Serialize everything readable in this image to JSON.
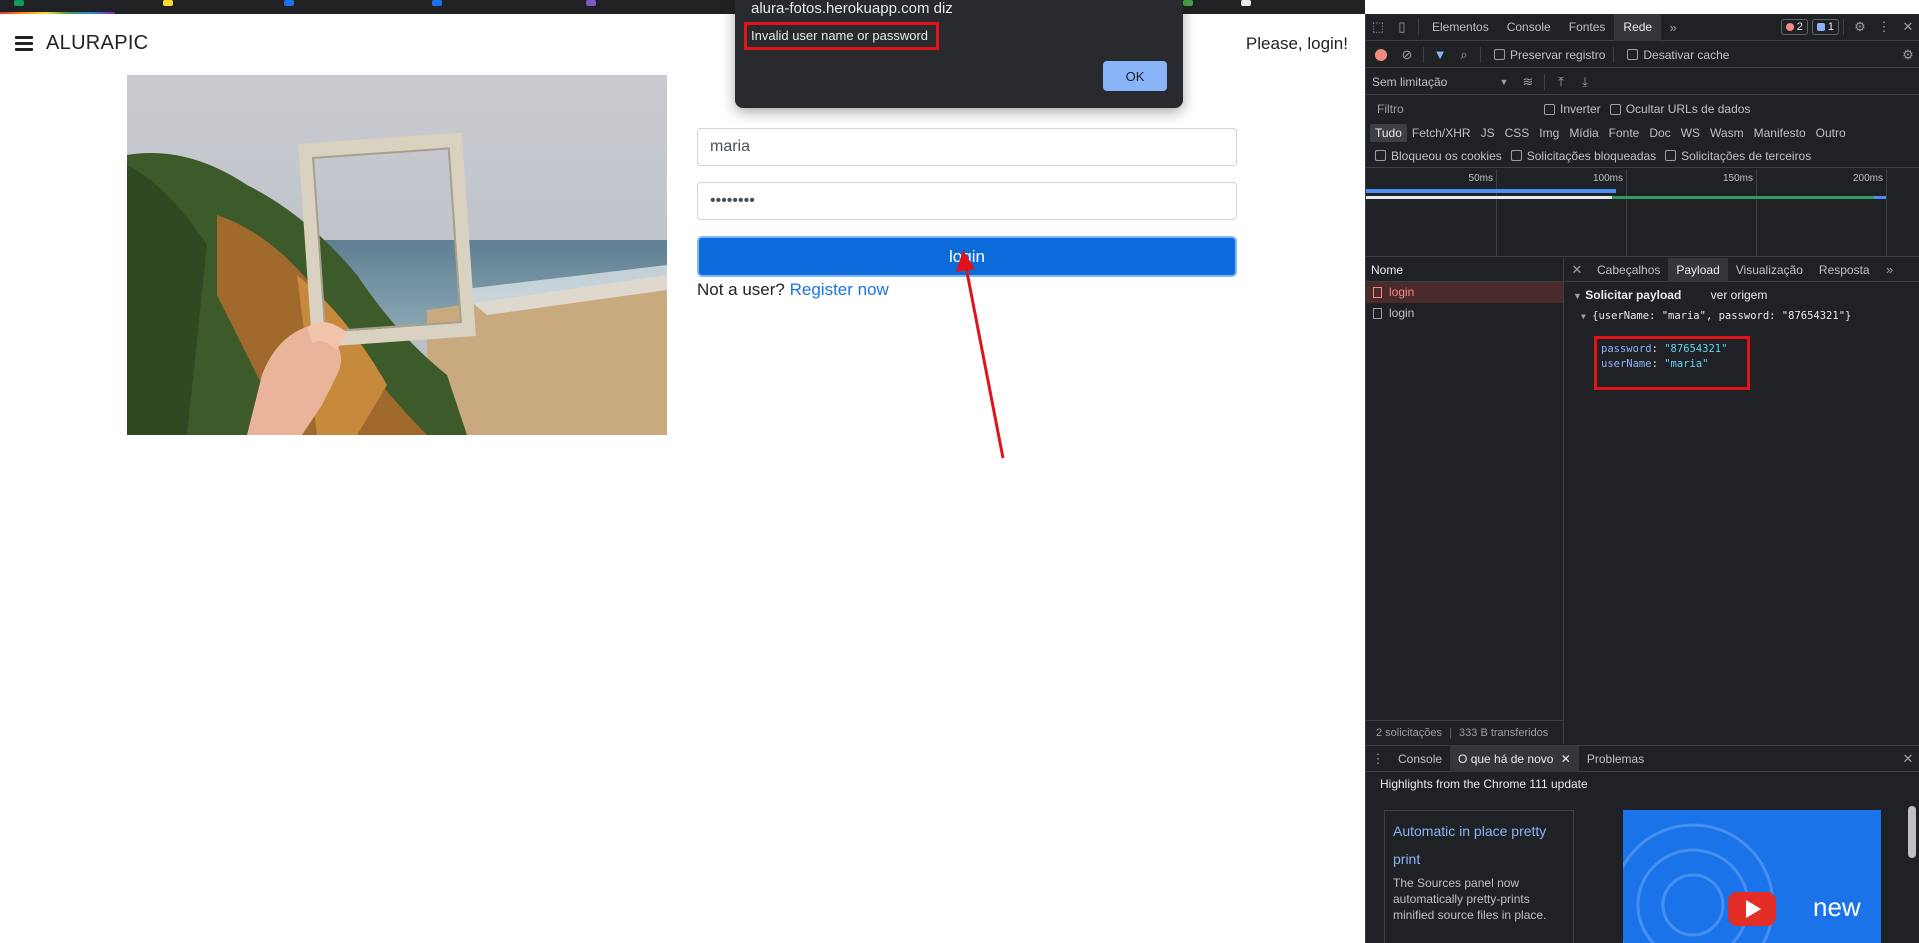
{
  "page": {
    "brand": "ALURAPIC",
    "nav_right": "Please, login!",
    "username_value": "maria",
    "password_value": "••••••••",
    "login_button": "login",
    "register_prefix": "Not a user?",
    "register_link": "Register now"
  },
  "alert": {
    "title": "alura-fotos.herokuapp.com diz",
    "message": "Invalid user name or password",
    "ok_label": "OK"
  },
  "devtools": {
    "tabs": [
      "Elementos",
      "Console",
      "Fontes",
      "Rede"
    ],
    "active_tab": "Rede",
    "error_count": "2",
    "message_count": "1",
    "preserve_log": "Preservar registro",
    "disable_cache": "Desativar cache",
    "throttling": "Sem limitação",
    "filter_placeholder": "Filtro",
    "invert": "Inverter",
    "hide_data_urls": "Ocultar URLs de dados",
    "type_filters": [
      "Tudo",
      "Fetch/XHR",
      "JS",
      "CSS",
      "Img",
      "Mídia",
      "Fonte",
      "Doc",
      "WS",
      "Wasm",
      "Manifesto",
      "Outro"
    ],
    "blocked_cookies": "Bloqueou os cookies",
    "blocked_requests": "Solicitações bloqueadas",
    "third_party": "Solicitações de terceiros",
    "timeline_ticks": [
      "50ms",
      "100ms",
      "150ms",
      "200ms"
    ],
    "name_header": "Nome",
    "requests": [
      {
        "name": "login",
        "error": true
      },
      {
        "name": "login",
        "error": false
      }
    ],
    "status_requests": "2 solicitações",
    "status_transferred": "333 B transferidos",
    "detail_tabs": [
      "Cabeçalhos",
      "Payload",
      "Visualização",
      "Resposta"
    ],
    "active_detail_tab": "Payload",
    "payload_header": "Solicitar payload",
    "view_source": "ver origem",
    "payload_summary": "{userName: \"maria\", password: \"87654321\"}",
    "payload_password_key": "password",
    "payload_password_val": "\"87654321\"",
    "payload_username_key": "userName",
    "payload_username_val": "\"maria\"",
    "drawer_tabs": [
      "Console",
      "O que há de novo",
      "Problemas"
    ],
    "active_drawer_tab": "O que há de novo",
    "whats_new_title": "Highlights from the Chrome 111 update",
    "card_title": "Automatic in place pretty print",
    "card_desc": "The Sources panel now automatically pretty-prints minified source files in place.",
    "thumb_label": "new"
  },
  "colors": {
    "login_button": "#0b6bdb",
    "annotation_red": "#e0121a",
    "devtools_bg": "#202124",
    "link": "#1a73e8"
  }
}
